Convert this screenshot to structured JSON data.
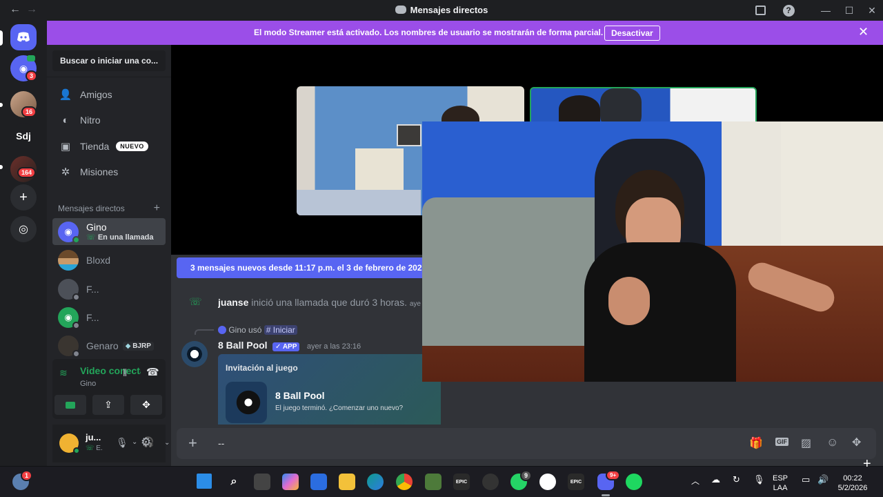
{
  "titlebar": {
    "title": "Mensajes directos"
  },
  "banner": {
    "message": "El modo Streamer está activado. Los nombres de usuario se mostrarán de forma parcial.",
    "button": "Desactivar"
  },
  "servers": {
    "badges": [
      "3",
      "16",
      "164"
    ],
    "text_server": "Sdj"
  },
  "sidebar": {
    "search_placeholder": "Buscar o iniciar una co...",
    "nav": [
      {
        "label": "Amigos",
        "icon": "friends-icon"
      },
      {
        "label": "Nitro",
        "icon": "nitro-icon"
      },
      {
        "label": "Tienda",
        "icon": "shop-icon",
        "badge": "NUEVO"
      },
      {
        "label": "Misiones",
        "icon": "quests-icon"
      }
    ],
    "dm_header": "Mensajes directos",
    "dms": [
      {
        "name": "Gino",
        "status": "En una llamada"
      },
      {
        "name": "Bloxd"
      },
      {
        "name": "F..."
      },
      {
        "name": "F..."
      },
      {
        "name": "Genaro",
        "tag": "BJRP"
      }
    ]
  },
  "voice": {
    "title": "Video conectac",
    "subtitle": "Gino"
  },
  "user": {
    "name": "ju...",
    "status": "E."
  },
  "chat": {
    "new_messages": "3 mensajes nuevos desde 11:17 p.m. el 3 de febrero de 2026",
    "call_user": "juanse",
    "call_text": "inició una llamada que duró 3 horas.",
    "call_time": "aye",
    "reply_user": "Gino usó",
    "reply_command": "Iniciar",
    "author": "8 Ball Pool",
    "app_tag": "APP",
    "timestamp": "ayer a las 23:16",
    "embed_title": "Invitación al juego",
    "game_name": "8 Ball Pool",
    "game_text": "El juego terminó. ¿Comenzar uno nuevo?",
    "composer_text": "--"
  },
  "taskbar": {
    "epic1": "EPIC",
    "epic2": "EPIC",
    "whatsapp_badge": "9",
    "discord_badge": "9+",
    "weather_badge": "1",
    "lang1": "ESP",
    "lang2": "LAA",
    "time": "00:22",
    "date": "5/2/2026"
  },
  "colors": {
    "blurple": "#5865f2",
    "streamer_banner": "#9b4ee8",
    "online": "#23a55a"
  }
}
